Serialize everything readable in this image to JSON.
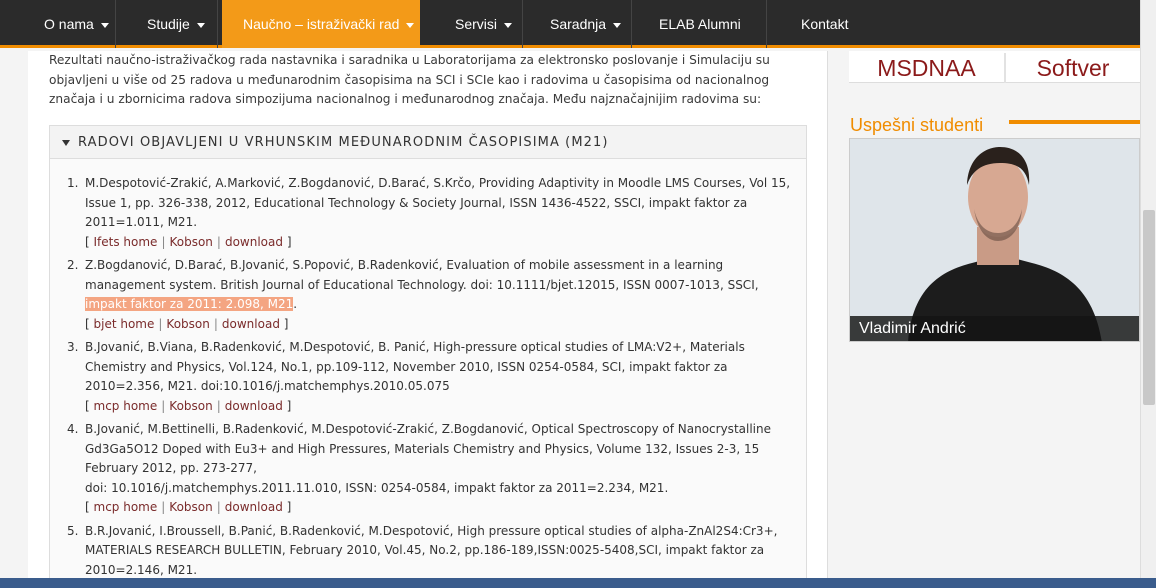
{
  "nav": {
    "items": [
      {
        "label": "O nama",
        "caret": true,
        "active": false
      },
      {
        "label": "Studije",
        "caret": true,
        "active": false
      },
      {
        "label": "Naučno – istraživački rad",
        "caret": true,
        "active": true
      },
      {
        "label": "Servisi",
        "caret": true,
        "active": false
      },
      {
        "label": "Saradnja",
        "caret": true,
        "active": false
      },
      {
        "label": "ELAB Alumni",
        "caret": false,
        "active": false
      },
      {
        "label": "Kontakt",
        "caret": false,
        "active": false
      }
    ],
    "accent": "#f39a18"
  },
  "intro": "Rezultati naučno-istraživačkog rada nastavnika i saradnika u Laboratorijama za elektronsko poslovanje i Simulaciju su objavljeni u više od 25 radova u međunarodnim časopisima na SCI i SCIe kao i radovima u časopisima od nacionalnog značaja i u zbornicima radova simpozijuma nacionalnog i međunarodnog značaja. Među najznačajnijim radovima su:",
  "section": {
    "title": "RADOVI OBJAVLJENI U VRHUNSKIM MEĐUNARODNIM ČASOPISIMA (M21)"
  },
  "refs": [
    {
      "num": "1.",
      "text": "M.Despotović-Zrakić, A.Marković, Z.Bogdanović, D.Barać, S.Krčo, Providing Adaptivity in Moodle LMS Courses, Vol 15, Issue 1, pp. 326-338, 2012, Educational Technology & Society Journal, ISSN 1436-4522, SSCI, impakt faktor za 2011=1.011, M21.",
      "highlight": "",
      "tail": "",
      "links": [
        "Ifets home",
        "Kobson",
        "download"
      ]
    },
    {
      "num": "2.",
      "text": "Z.Bogdanović, D.Barać, B.Jovanić, S.Popović, B.Radenković, Evaluation of mobile assessment in a learning management system. British Journal of Educational Technology. doi: 10.1111/bjet.12015, ISSN 0007-1013, SSCI, ",
      "highlight": "impakt faktor za 2011: 2.098, M21",
      "tail": ".",
      "links": [
        "bjet home",
        "Kobson",
        "download"
      ]
    },
    {
      "num": "3.",
      "text": "B.Jovanić, B.Viana, B.Radenković, M.Despotović, B. Panić, High-pressure optical studies of LMA:V2+, Materials Chemistry and Physics, Vol.124, No.1, pp.109-112, November 2010, ISSN 0254-0584, SCI, impakt faktor za 2010=2.356, M21. doi:10.1016/j.matchemphys.2010.05.075",
      "highlight": "",
      "tail": "",
      "links": [
        "mcp home",
        "Kobson",
        "download"
      ]
    },
    {
      "num": "4.",
      "text": "B.Jovanić, M.Bettinelli, B.Radenković, M.Despotović-Zrakić, Z.Bogdanović, Optical Spectroscopy of Nanocrystalline Gd3Ga5O12 Doped with Eu3+ and High Pressures, Materials Chemistry and Physics, Volume 132, Issues 2-3, 15 February 2012, pp. 273-277,",
      "text2": "doi: 10.1016/j.matchemphys.2011.11.010, ISSN: 0254-0584, impakt faktor za 2011=2.234, M21.",
      "highlight": "",
      "tail": "",
      "links": [
        "mcp home",
        "Kobson",
        "download"
      ]
    },
    {
      "num": "5.",
      "text": "B.R.Jovanić, I.Broussell, B.Panić, B.Radenković, M.Despotović, High pressure optical studies of alpha-ZnAl2S4:Cr3+, MATERIALS RESEARCH BULLETIN, February 2010, Vol.45, No.2, pp.186-189,ISSN:0025-5408,SCI, impakt faktor za 2010=2.146, M21.",
      "highlight": "",
      "tail": "",
      "links": []
    }
  ],
  "sidebar": {
    "tab1": "MSDNAA",
    "tab2": "Softver",
    "title": "Uspešni studenti",
    "caption": "Vladimir Andrić"
  }
}
